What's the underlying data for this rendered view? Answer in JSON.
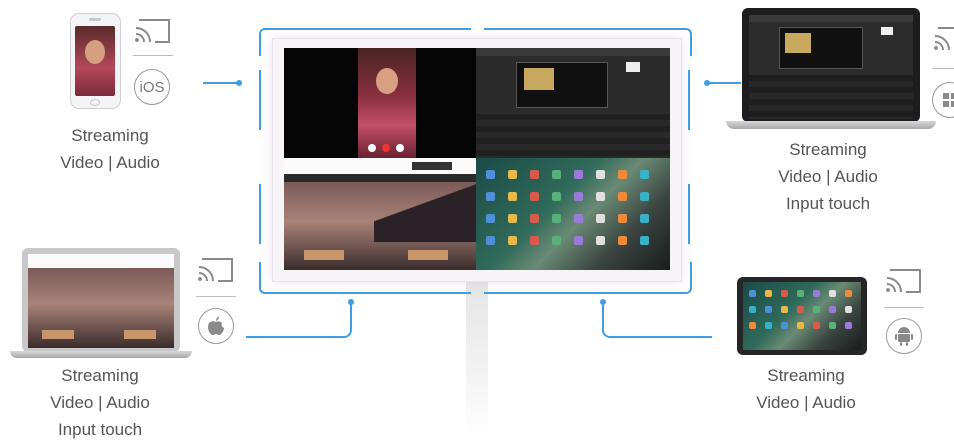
{
  "devices": {
    "iphone": {
      "platform_label": "iOS",
      "caption_line1": "Streaming",
      "caption_line2": "Video | Audio"
    },
    "windows_laptop": {
      "caption_line1": "Streaming",
      "caption_line2": "Video | Audio",
      "caption_line3": "Input touch"
    },
    "mac_laptop": {
      "caption_line1": "Streaming",
      "caption_line2": "Video | Audio",
      "caption_line3": "Input touch"
    },
    "android_tablet": {
      "caption_line1": "Streaming",
      "caption_line2": "Video | Audio"
    }
  },
  "icons": [
    "cast-icon",
    "ios-icon",
    "windows-icon",
    "apple-icon",
    "android-icon"
  ],
  "colors": {
    "accent": "#3d9ee5",
    "caption_text": "#555555"
  }
}
